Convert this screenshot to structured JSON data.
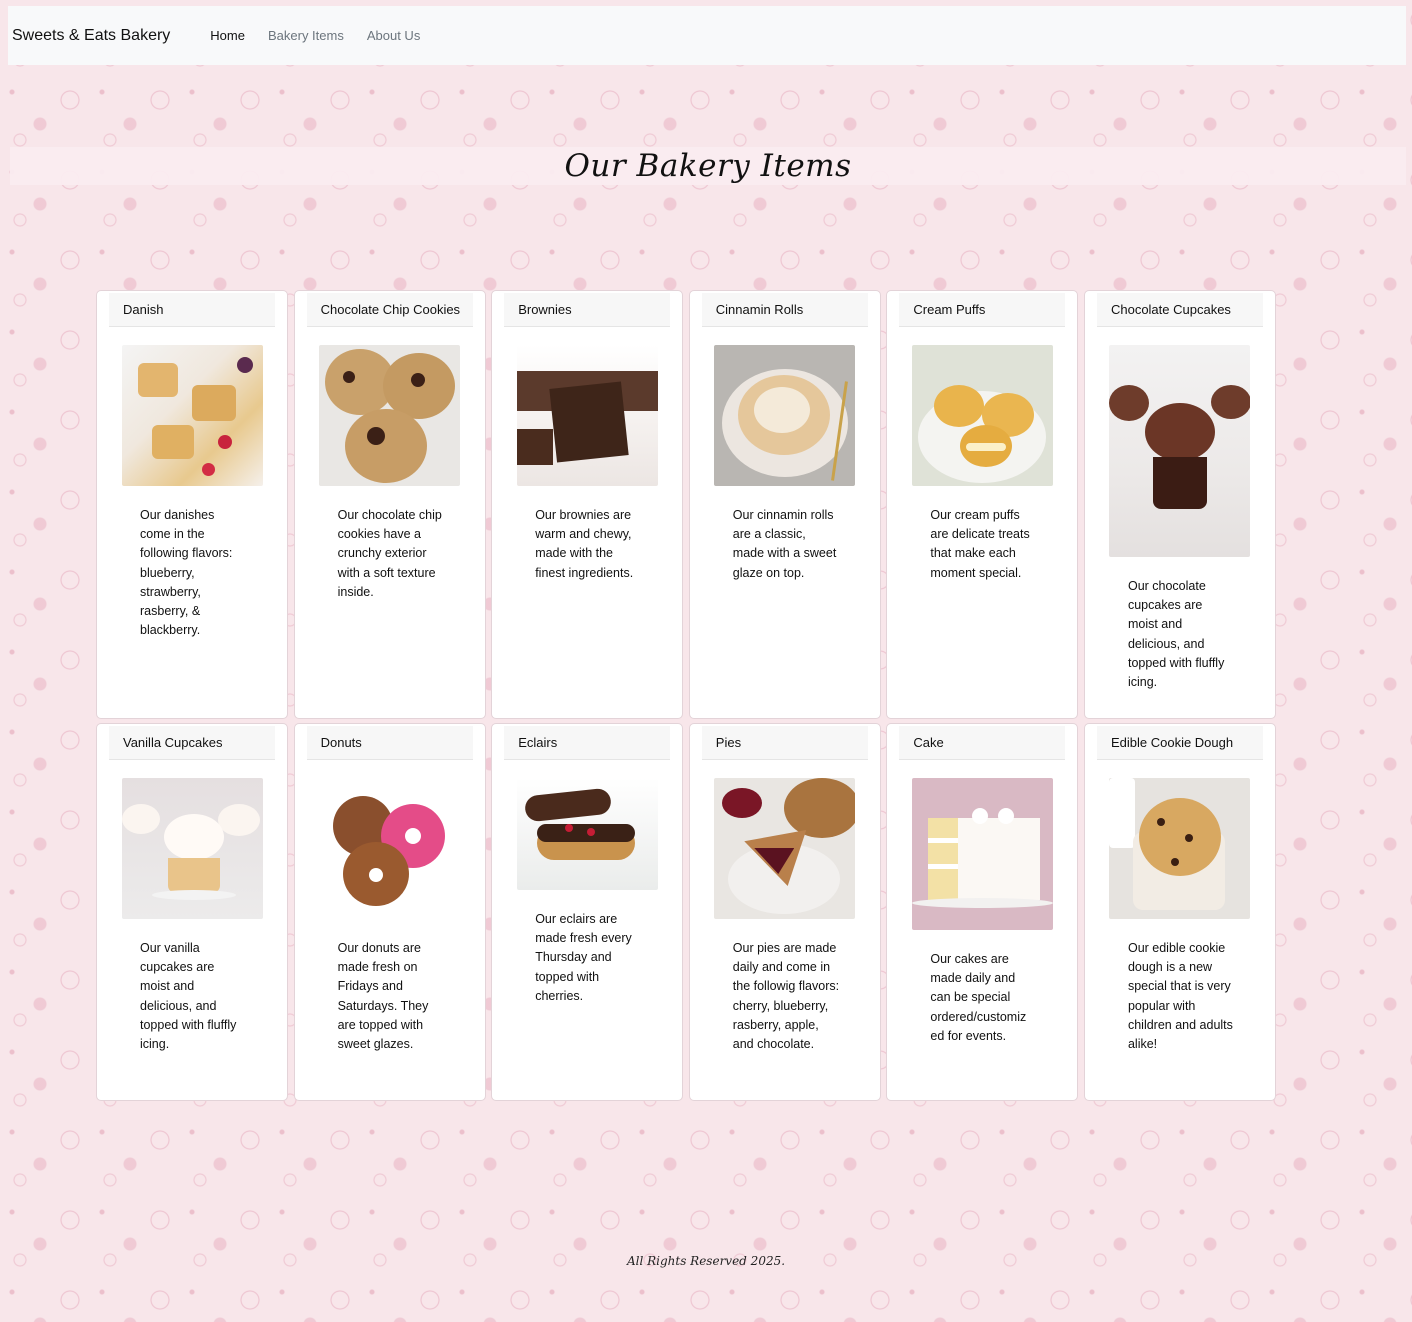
{
  "navbar": {
    "brand": "Sweets & Eats Bakery",
    "links": [
      {
        "label": "Home",
        "active": true
      },
      {
        "label": "Bakery Items",
        "active": false
      },
      {
        "label": "About Us",
        "active": false
      }
    ]
  },
  "page": {
    "title": "Our Bakery Items"
  },
  "items": [
    {
      "name": "Danish",
      "image_icon": "danish-image",
      "description": "Our danishes come in the following flavors: blueberry, strawberry, rasberry, & blackberry."
    },
    {
      "name": "Chocolate Chip Cookies",
      "image_icon": "cookies-image",
      "description": "Our chocolate chip cookies have a crunchy exterior with a soft texture inside."
    },
    {
      "name": "Brownies",
      "image_icon": "brownies-image",
      "description": "Our brownies are warm and chewy, made with the finest ingredients."
    },
    {
      "name": "Cinnamin Rolls",
      "image_icon": "cinnamon-roll-image",
      "description": "Our cinnamin rolls are a classic, made with a sweet glaze on top."
    },
    {
      "name": "Cream Puffs",
      "image_icon": "cream-puffs-image",
      "description": "Our cream puffs are delicate treats that make each moment special."
    },
    {
      "name": "Chocolate Cupcakes",
      "image_icon": "chocolate-cupcake-image",
      "description": "Our chocolate cupcakes are moist and delicious, and topped with fluffly icing."
    },
    {
      "name": "Vanilla Cupcakes",
      "image_icon": "vanilla-cupcake-image",
      "description": "Our vanilla cupcakes are moist and delicious, and topped with fluffly icing."
    },
    {
      "name": "Donuts",
      "image_icon": "donuts-image",
      "description": "Our donuts are made fresh on Fridays and Saturdays. They are topped with sweet glazes."
    },
    {
      "name": "Eclairs",
      "image_icon": "eclairs-image",
      "description": "Our eclairs are made fresh every Thursday and topped with cherries."
    },
    {
      "name": "Pies",
      "image_icon": "pie-image",
      "description": "Our pies are made daily and come in the followig flavors: cherry, blueberry, rasberry, apple, and chocolate."
    },
    {
      "name": "Cake",
      "image_icon": "cake-image",
      "description": "Our cakes are made daily and can be special ordered/customiz ed for events."
    },
    {
      "name": "Edible Cookie Dough",
      "image_icon": "cookie-dough-image",
      "description": "Our edible cookie dough is a new special that is very popular with children and adults alike!"
    }
  ],
  "footer": {
    "text": "All Rights Reserved 2025."
  }
}
